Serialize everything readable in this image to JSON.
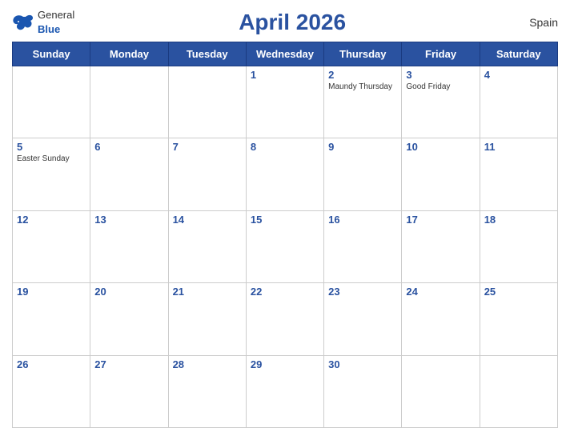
{
  "header": {
    "title": "April 2026",
    "country": "Spain",
    "logo": {
      "general": "General",
      "blue": "Blue"
    }
  },
  "weekdays": [
    "Sunday",
    "Monday",
    "Tuesday",
    "Wednesday",
    "Thursday",
    "Friday",
    "Saturday"
  ],
  "weeks": [
    [
      {
        "day": "",
        "holiday": ""
      },
      {
        "day": "",
        "holiday": ""
      },
      {
        "day": "",
        "holiday": ""
      },
      {
        "day": "1",
        "holiday": ""
      },
      {
        "day": "2",
        "holiday": "Maundy Thursday"
      },
      {
        "day": "3",
        "holiday": "Good Friday"
      },
      {
        "day": "4",
        "holiday": ""
      }
    ],
    [
      {
        "day": "5",
        "holiday": "Easter Sunday"
      },
      {
        "day": "6",
        "holiday": ""
      },
      {
        "day": "7",
        "holiday": ""
      },
      {
        "day": "8",
        "holiday": ""
      },
      {
        "day": "9",
        "holiday": ""
      },
      {
        "day": "10",
        "holiday": ""
      },
      {
        "day": "11",
        "holiday": ""
      }
    ],
    [
      {
        "day": "12",
        "holiday": ""
      },
      {
        "day": "13",
        "holiday": ""
      },
      {
        "day": "14",
        "holiday": ""
      },
      {
        "day": "15",
        "holiday": ""
      },
      {
        "day": "16",
        "holiday": ""
      },
      {
        "day": "17",
        "holiday": ""
      },
      {
        "day": "18",
        "holiday": ""
      }
    ],
    [
      {
        "day": "19",
        "holiday": ""
      },
      {
        "day": "20",
        "holiday": ""
      },
      {
        "day": "21",
        "holiday": ""
      },
      {
        "day": "22",
        "holiday": ""
      },
      {
        "day": "23",
        "holiday": ""
      },
      {
        "day": "24",
        "holiday": ""
      },
      {
        "day": "25",
        "holiday": ""
      }
    ],
    [
      {
        "day": "26",
        "holiday": ""
      },
      {
        "day": "27",
        "holiday": ""
      },
      {
        "day": "28",
        "holiday": ""
      },
      {
        "day": "29",
        "holiday": ""
      },
      {
        "day": "30",
        "holiday": ""
      },
      {
        "day": "",
        "holiday": ""
      },
      {
        "day": "",
        "holiday": ""
      }
    ]
  ]
}
